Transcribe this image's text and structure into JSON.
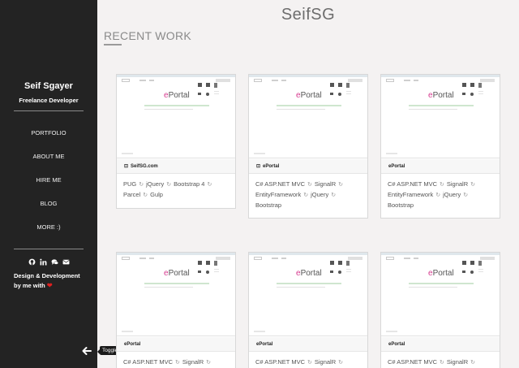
{
  "site": {
    "title": "SeifSG"
  },
  "sidebar": {
    "name": "Seif Sgayer",
    "role": "Freelance Developer",
    "nav": [
      "PORTFOLIO",
      "ABOUT ME",
      "HIRE ME",
      "BLOG",
      "MORE :)"
    ],
    "credit_line1": "Design & Development",
    "credit_line2": "by me with",
    "social_icons": [
      "github-icon",
      "linkedin-icon",
      "chat-icon",
      "email-icon"
    ]
  },
  "toggle": {
    "tooltip": "Toggle Magic!"
  },
  "section": {
    "title": "RECENT WORK"
  },
  "thumb": {
    "logo_e": "e",
    "logo_rest": "Portal"
  },
  "cards": [
    {
      "label": "SeifSG.com",
      "tags_line1": [
        "PUG",
        "jQuery",
        "Bootstrap 4"
      ],
      "tags_line2": [
        "Parcel",
        "Gulp"
      ],
      "tags_line3": []
    },
    {
      "label": "ePortal",
      "tags_line1": [
        "C# ASP.NET MVC",
        "SignalR"
      ],
      "tags_line2": [
        "EntityFramework",
        "jQuery"
      ],
      "tags_line3": [
        "Bootstrap"
      ]
    },
    {
      "label": "ePortal",
      "tags_line1": [
        "C# ASP.NET MVC",
        "SignalR"
      ],
      "tags_line2": [
        "EntityFramework",
        "jQuery"
      ],
      "tags_line3": [
        "Bootstrap"
      ]
    },
    {
      "label": "ePortal",
      "tags_line1": [
        "C# ASP.NET MVC",
        "SignalR"
      ],
      "tags_line2": [],
      "tags_line3": []
    },
    {
      "label": "ePortal",
      "tags_line1": [
        "C# ASP.NET MVC",
        "SignalR"
      ],
      "tags_line2": [],
      "tags_line3": []
    },
    {
      "label": "ePortal",
      "tags_line1": [
        "C# ASP.NET MVC",
        "SignalR"
      ],
      "tags_line2": [],
      "tags_line3": []
    }
  ],
  "colors": {
    "sidebar": "#232323",
    "background": "#f4f2f2",
    "heart": "#e02020",
    "logo_accent": "#d63b8f"
  }
}
